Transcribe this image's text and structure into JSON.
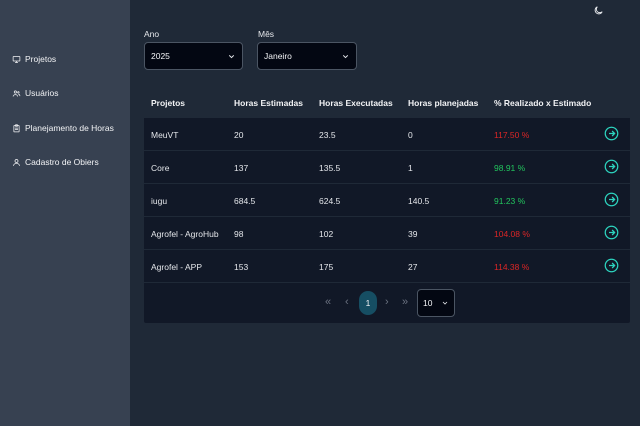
{
  "sidebar": {
    "items": [
      {
        "label": "Projetos",
        "icon": "monitor-icon"
      },
      {
        "label": "Usuários",
        "icon": "users-icon"
      },
      {
        "label": "Planejamento de Horas",
        "icon": "clipboard-icon"
      },
      {
        "label": "Cadastro de Obiers",
        "icon": "user-icon"
      }
    ]
  },
  "header": {
    "theme_icon": "moon-icon"
  },
  "filters": {
    "year": {
      "label": "Ano",
      "value": "2025"
    },
    "month": {
      "label": "Mês",
      "value": "Janeiro"
    }
  },
  "table": {
    "headers": [
      "Projetos",
      "Horas Estimadas",
      "Horas Executadas",
      "Horas planejadas",
      "% Realizado x Estimado"
    ],
    "rows": [
      {
        "projeto": "MeuVT",
        "estimadas": "20",
        "executadas": "23.5",
        "planejadas": "0",
        "pct": "117.50 %",
        "status": "over"
      },
      {
        "projeto": "Core",
        "estimadas": "137",
        "executadas": "135.5",
        "planejadas": "1",
        "pct": "98.91 %",
        "status": "ok"
      },
      {
        "projeto": "iugu",
        "estimadas": "684.5",
        "executadas": "624.5",
        "planejadas": "140.5",
        "pct": "91.23 %",
        "status": "ok"
      },
      {
        "projeto": "Agrofel - AgroHub",
        "estimadas": "98",
        "executadas": "102",
        "planejadas": "39",
        "pct": "104.08 %",
        "status": "over"
      },
      {
        "projeto": "Agrofel - APP",
        "estimadas": "153",
        "executadas": "175",
        "planejadas": "27",
        "pct": "114.38 %",
        "status": "over"
      }
    ],
    "row_action_icon": "arrow-right-circle-icon"
  },
  "pagination": {
    "first": "«",
    "prev": "‹",
    "current": "1",
    "next": "›",
    "last": "»",
    "page_size": "10"
  },
  "colors": {
    "over": "#dc2626",
    "ok": "#22c55e",
    "action": "#2dd4bf"
  }
}
